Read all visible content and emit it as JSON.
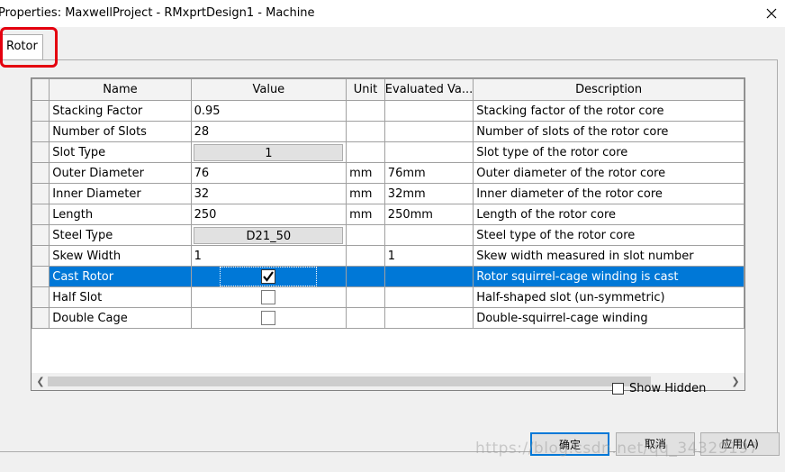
{
  "window": {
    "title": "Properties: MaxwellProject - RMxprtDesign1 - Machine",
    "close_icon": "close-icon"
  },
  "tabs": [
    {
      "label": "Rotor",
      "active": true
    }
  ],
  "grid": {
    "columns": [
      "Name",
      "Value",
      "Unit",
      "Evaluated Va...",
      "Description"
    ],
    "rows": [
      {
        "name": "Stacking Factor",
        "value": "0.95",
        "unit": "",
        "evaluated": "",
        "description": "Stacking factor of the rotor core",
        "kind": "text"
      },
      {
        "name": "Number of Slots",
        "value": "28",
        "unit": "",
        "evaluated": "",
        "description": "Number of slots of the rotor core",
        "kind": "text"
      },
      {
        "name": "Slot Type",
        "value": "1",
        "unit": "",
        "evaluated": "",
        "description": "Slot type of the rotor core",
        "kind": "button"
      },
      {
        "name": "Outer Diameter",
        "value": "76",
        "unit": "mm",
        "evaluated": "76mm",
        "description": "Outer diameter of the rotor core",
        "kind": "text"
      },
      {
        "name": "Inner Diameter",
        "value": "32",
        "unit": "mm",
        "evaluated": "32mm",
        "description": "Inner diameter of the rotor core",
        "kind": "text"
      },
      {
        "name": "Length",
        "value": "250",
        "unit": "mm",
        "evaluated": "250mm",
        "description": "Length of the rotor core",
        "kind": "text"
      },
      {
        "name": "Steel Type",
        "value": "D21_50",
        "unit": "",
        "evaluated": "",
        "description": "Steel type of the rotor core",
        "kind": "button"
      },
      {
        "name": "Skew Width",
        "value": "1",
        "unit": "",
        "evaluated": "1",
        "description": "Skew width measured in slot number",
        "kind": "text"
      },
      {
        "name": "Cast Rotor",
        "checked": true,
        "unit": "",
        "evaluated": "",
        "description": "Rotor squirrel-cage winding is cast",
        "kind": "checkbox",
        "selected": true
      },
      {
        "name": "Half Slot",
        "checked": false,
        "unit": "",
        "evaluated": "",
        "description": "Half-shaped slot (un-symmetric)",
        "kind": "checkbox"
      },
      {
        "name": "Double Cage",
        "checked": false,
        "unit": "",
        "evaluated": "",
        "description": "Double-squirrel-cage winding",
        "kind": "checkbox"
      }
    ],
    "selection_color": "#0078d7"
  },
  "show_hidden": {
    "label": "Show Hidden",
    "checked": false
  },
  "buttons": {
    "ok": "确定",
    "cancel": "取消",
    "apply": "应用(A)"
  },
  "watermark": "https://blog.csdn.net/qq_34329197"
}
